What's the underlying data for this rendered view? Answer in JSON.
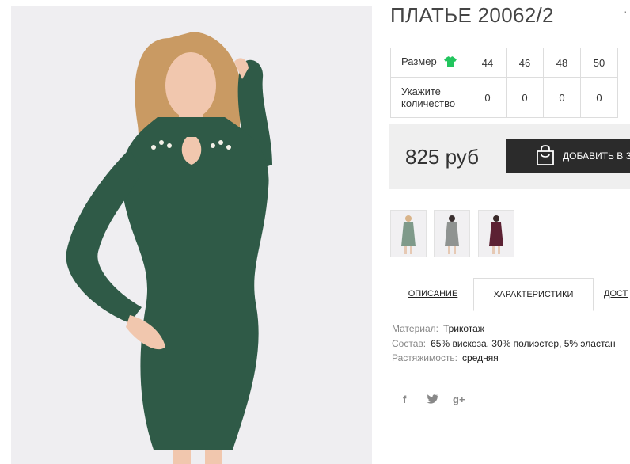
{
  "product": {
    "title": "ПЛАТЬЕ 20062/2",
    "price": "825 руб",
    "add_to_cart": "ДОБАВИТЬ В ЗА"
  },
  "sizes": {
    "size_label": "Размер",
    "qty_label": "Укажите количество",
    "values": [
      "44",
      "46",
      "48",
      "50"
    ],
    "quantities": [
      "0",
      "0",
      "0",
      "0"
    ]
  },
  "thumbnails": [
    "green-dress",
    "grey-dress",
    "burgundy-dress"
  ],
  "tabs": [
    "ОПИСАНИЕ",
    "ХАРАКТЕРИСТИКИ",
    "ДОСТ"
  ],
  "active_tab": "ХАРАКТЕРИСТИКИ",
  "specs": [
    {
      "key": "Материал:",
      "value": "Трикотаж"
    },
    {
      "key": "Состав:",
      "value": "65% вискоза, 30% полиэстер, 5% эластан"
    },
    {
      "key": "Растяжимость:",
      "value": "средняя"
    }
  ],
  "social": [
    "f",
    "twitter-icon",
    "g+"
  ],
  "colors": {
    "dress": "#2f5a47",
    "size_icon": "#22c55e",
    "button": "#2b2b2b",
    "price_bg": "#efefef"
  }
}
